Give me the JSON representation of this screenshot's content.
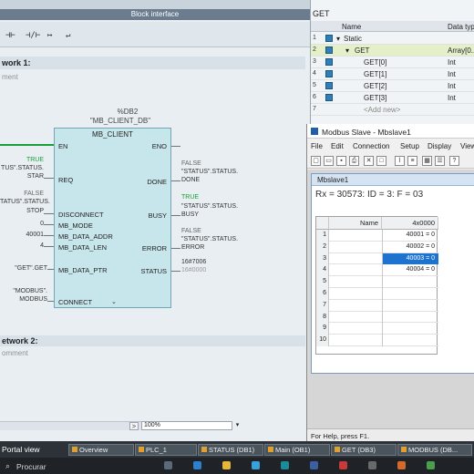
{
  "tia": {
    "block_interface": "Block interface",
    "toolbar_icons": [
      "contact-no",
      "contact-nc",
      "coil",
      "branch-open",
      "branch-close"
    ],
    "network1_title": "work 1:",
    "network1_comment": "ment",
    "block": {
      "db_label": "%DB2",
      "instance": "\"MB_CLIENT_DB\"",
      "name": "MB_CLIENT",
      "pins_left": [
        "EN",
        "REQ",
        "DISCONNECT",
        "MB_MODE",
        "MB_DATA_ADDR",
        "MB_DATA_LEN",
        "MB_DATA_PTR",
        "CONNECT"
      ],
      "pins_right": [
        "ENO",
        "DONE",
        "BUSY",
        "ERROR",
        "STATUS"
      ]
    },
    "params_left": {
      "req_value": "TRUE",
      "req_tag_1": "TUS\".STATUS.",
      "req_tag_2": "STAR",
      "disc_value": "FALSE",
      "disc_tag_1": "TATUS\".STATUS.",
      "disc_tag_2": "STOP",
      "mode": "0",
      "addr": "40001",
      "len": "4",
      "ptr": "\"GET\".GET",
      "connect_1": "\"MODBUS\".",
      "connect_2": "MODBUS"
    },
    "params_right": {
      "done_value": "FALSE",
      "done_tag_1": "\"STATUS\".STATUS.",
      "done_tag_2": "DONE",
      "busy_value": "TRUE",
      "busy_tag_1": "\"STATUS\".STATUS.",
      "busy_tag_2": "BUSY",
      "error_value": "FALSE",
      "error_tag_1": "\"STATUS\".STATUS.",
      "error_tag_2": "ERROR",
      "status_value": "16#7006",
      "status_tag": "16#0000"
    },
    "network2_title": "etwork 2:",
    "network2_comment": "omment",
    "zoom": "100%"
  },
  "iface": {
    "title": "GET",
    "col_name": "Name",
    "col_type": "Data typ",
    "rows": [
      {
        "num": "1",
        "name": "Static",
        "type": ""
      },
      {
        "num": "2",
        "name": "GET",
        "type": "Array[0.."
      },
      {
        "num": "3",
        "name": "GET[0]",
        "type": "Int"
      },
      {
        "num": "4",
        "name": "GET[1]",
        "type": "Int"
      },
      {
        "num": "5",
        "name": "GET[2]",
        "type": "Int"
      },
      {
        "num": "6",
        "name": "GET[3]",
        "type": "Int"
      },
      {
        "num": "7",
        "name": "<Add new>",
        "type": ""
      }
    ]
  },
  "modbus": {
    "window_title": "Modbus Slave - Mbslave1",
    "menu": [
      "File",
      "Edit",
      "Connection",
      "Setup",
      "Display",
      "View"
    ],
    "toolbar_icons": [
      "new",
      "open",
      "save",
      "print",
      "delete",
      "window",
      "chart",
      "register",
      "grid",
      "list",
      "help"
    ],
    "child_title": "Mbslave1",
    "status": "Rx = 30573: ID = 3: F = 03",
    "grid_col_name": "Name",
    "grid_col_addr": "4x0000",
    "rows": [
      {
        "idx": "1",
        "value": "40001 = 0"
      },
      {
        "idx": "2",
        "value": "40002 = 0"
      },
      {
        "idx": "3",
        "value": "40003 = 0"
      },
      {
        "idx": "4",
        "value": "40004 = 0"
      },
      {
        "idx": "5",
        "value": ""
      },
      {
        "idx": "6",
        "value": ""
      },
      {
        "idx": "7",
        "value": ""
      },
      {
        "idx": "8",
        "value": ""
      },
      {
        "idx": "9",
        "value": ""
      },
      {
        "idx": "10",
        "value": ""
      }
    ],
    "selected_row": "3",
    "statusbar": "For Help, press F1."
  },
  "taskbar": {
    "portal_view": "Portal view",
    "tabs": [
      "Overview",
      "PLC_1",
      "STATUS (DB1)",
      "Main (OB1)",
      "GET (DB3)",
      "MODBUS (DB..."
    ],
    "search": "Procurar"
  },
  "colors": {
    "rung": "#19a038",
    "block_fill": "#c7e6ec",
    "selection": "#1e72d0"
  }
}
